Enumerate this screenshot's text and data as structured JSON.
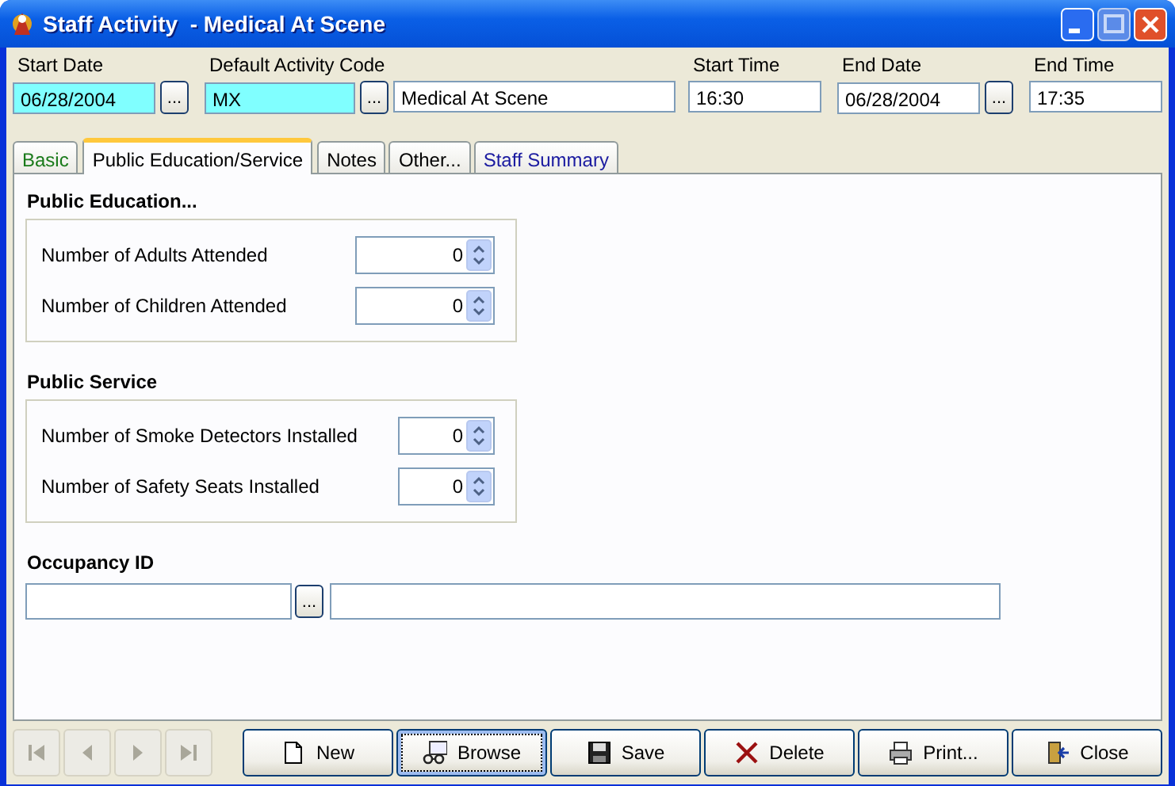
{
  "window": {
    "title": "Staff Activity  - Medical At Scene"
  },
  "header_fields": [
    {
      "label": "Start Date",
      "value": "06/28/2004",
      "highlighted": true,
      "picker": "..."
    },
    {
      "label": "Default Activity Code",
      "value": "MX",
      "highlighted": true,
      "picker": "..."
    },
    {
      "value": "Medical At Scene",
      "highlighted": false
    },
    {
      "label": "Start Time",
      "value": "16:30",
      "highlighted": false
    },
    {
      "label": "End Date",
      "value": "06/28/2004",
      "highlighted": false,
      "picker": "..."
    },
    {
      "label": "End Time",
      "value": "17:35",
      "highlighted": false
    }
  ],
  "tabs": [
    {
      "label": "Basic",
      "selected": false,
      "color": "#1a7a1a"
    },
    {
      "label": "Public Education/Service",
      "selected": true,
      "color": "#000000"
    },
    {
      "label": "Notes",
      "selected": false,
      "color": "#000000"
    },
    {
      "label": "Other...",
      "selected": false,
      "color": "#000000"
    },
    {
      "label": "Staff Summary",
      "selected": false,
      "color": "#1a1aa0"
    }
  ],
  "sections": [
    {
      "title": "Public Education...",
      "rows": [
        {
          "label": "Number of Adults Attended",
          "value": "0"
        },
        {
          "label": "Number of Children Attended",
          "value": "0"
        }
      ]
    },
    {
      "title": "Public Service",
      "rows": [
        {
          "label": "Number of Smoke Detectors Installed",
          "value": "0"
        },
        {
          "label": "Number of Safety Seats Installed",
          "value": "0"
        }
      ]
    }
  ],
  "occupancy": {
    "title": "Occupancy ID",
    "picker": "..."
  },
  "nav_buttons": [
    {
      "kind": "first",
      "disabled": true
    },
    {
      "kind": "prev",
      "disabled": true
    },
    {
      "kind": "next",
      "disabled": true
    },
    {
      "kind": "last",
      "disabled": true
    }
  ],
  "actions": [
    {
      "kind": "new",
      "label": "New",
      "focused": false
    },
    {
      "kind": "browse",
      "label": "Browse",
      "focused": true
    },
    {
      "kind": "save",
      "label": "Save",
      "focused": false
    },
    {
      "kind": "delete",
      "label": "Delete",
      "focused": false
    },
    {
      "kind": "print",
      "label": "Print...",
      "focused": false
    },
    {
      "kind": "close",
      "label": "Close",
      "focused": false
    }
  ]
}
